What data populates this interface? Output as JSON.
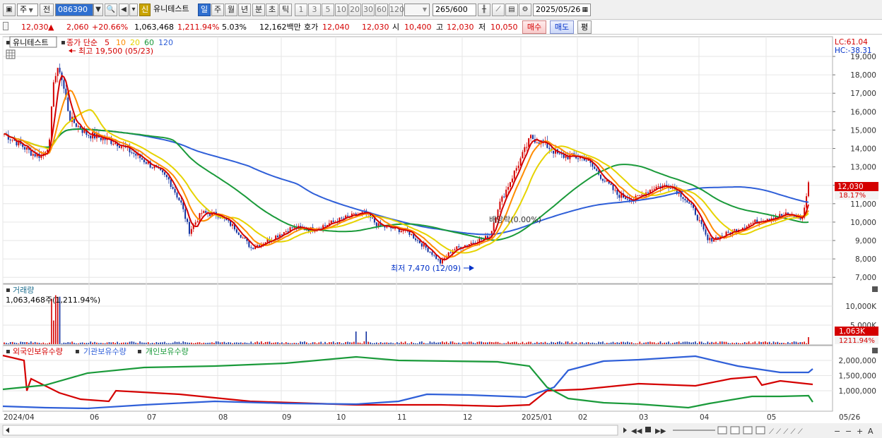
{
  "toolbar": {
    "type_label": "주",
    "prev_label": "전",
    "code_value": "086390",
    "stock_name": "유니테스트",
    "new_badge": "신",
    "periods": [
      "일",
      "주",
      "월",
      "년",
      "분",
      "초",
      "틱"
    ],
    "active_period": "일",
    "intervals": [
      "1",
      "3",
      "5",
      "10",
      "20",
      "30",
      "60",
      "120"
    ],
    "count_value": "265",
    "count_total": "/600",
    "date_value": "2025/05/26"
  },
  "quote": {
    "price": "12,030",
    "change_arrow": "▲",
    "change": "2,060",
    "change_pct": "+20.66%",
    "volume": "1,063,468",
    "vol_ratio": "1,211.94%",
    "turnover": "5.03%",
    "amount": "12,162백만",
    "bid_label": "호가",
    "bid1": "12,040",
    "bid2": "12,030",
    "open_label": "시",
    "open": "10,400",
    "high_label": "고",
    "high": "12,030",
    "low_label": "저",
    "low": "10,050",
    "buy_label": "매수",
    "sell_label": "매도",
    "eval_label": "평"
  },
  "price_panel": {
    "title": "유니테스트",
    "ma_prefix": "종가 단순",
    "ma_periods": [
      "5",
      "10",
      "20",
      "60",
      "120"
    ],
    "ma_colors": [
      "#d40000",
      "#ff8c00",
      "#e6d300",
      "#1a9a3a",
      "#2f5fd8"
    ],
    "lc_label": "LC:61.04",
    "hc_label": "HC:-38.31",
    "max_label": "최고 19,500 (05/23)",
    "min_label": "최저 7,470 (12/09)",
    "dividend_label": "배당락(0.00%)",
    "last_price_tag": "12,030",
    "last_pct_tag": "18.17%",
    "y_ticks": [
      "19,000",
      "18,000",
      "17,000",
      "16,000",
      "15,000",
      "14,000",
      "13,000",
      "12,000",
      "11,000",
      "10,000",
      "9,000",
      "8,000",
      "7,000"
    ]
  },
  "volume_panel": {
    "title": "거래량",
    "value_label": "1,063,468주(1,211.94%)",
    "y_ticks": [
      "10,000K",
      "5,000K"
    ],
    "last_tag": "1,063K",
    "last_pct_tag": "1211.94%"
  },
  "holding_panel": {
    "legend": [
      "외국인보유수량",
      "기관보유수량",
      "개인보유수량"
    ],
    "legend_colors": [
      "#d40000",
      "#2f5fd8",
      "#1a9a3a"
    ],
    "y_ticks": [
      "2,000,000",
      "1,500,000",
      "1,000,000"
    ]
  },
  "x_axis": {
    "labels": [
      "2024/04",
      "06",
      "07",
      "08",
      "09",
      "10",
      "11",
      "12",
      "2025/01",
      "02",
      "03",
      "04",
      "05",
      "05/26"
    ]
  },
  "colors": {
    "up": "#d40000",
    "down": "#1030a0",
    "grid": "#e6e6e6"
  }
}
